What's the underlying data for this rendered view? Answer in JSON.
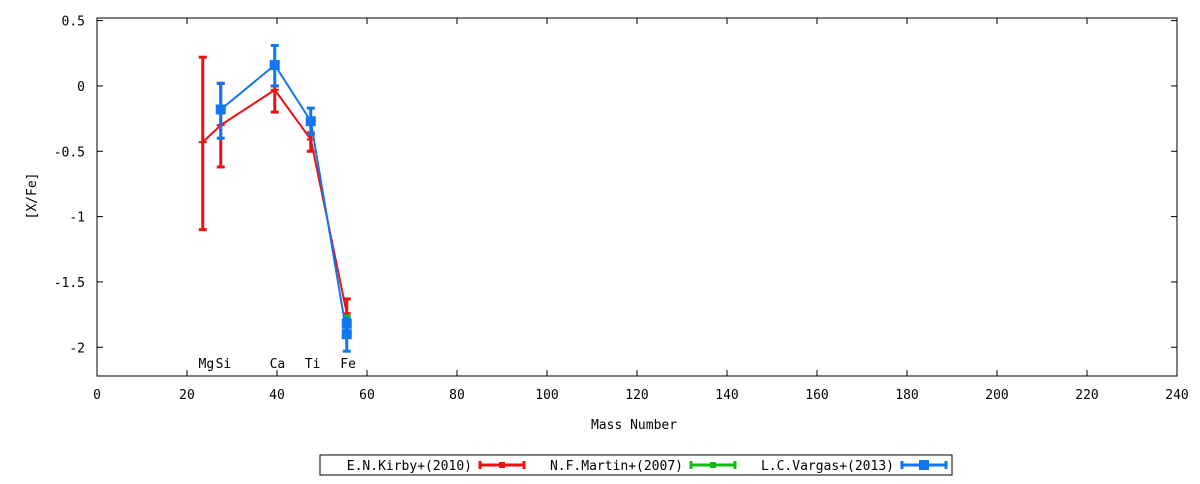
{
  "chart_data": {
    "type": "line",
    "xlabel": "Mass Number",
    "ylabel": "[X/Fe]",
    "xlim": [
      0,
      240
    ],
    "ylim": [
      -2.22,
      0.52
    ],
    "x_ticks": [
      0,
      20,
      40,
      60,
      80,
      100,
      120,
      140,
      160,
      180,
      200,
      220,
      240
    ],
    "y_ticks": [
      0.5,
      0,
      -0.5,
      -1,
      -1.5,
      -2
    ],
    "y_tick_labels": [
      "0.5",
      "0",
      "-0.5",
      "-1",
      "-1.5",
      "-2"
    ],
    "grid": false,
    "legend_position": "bottom-center",
    "element_labels": [
      {
        "text": "Mg",
        "x": 24.3
      },
      {
        "text": "Si",
        "x": 28.1
      },
      {
        "text": "Ca",
        "x": 40.1
      },
      {
        "text": "Ti",
        "x": 47.9
      },
      {
        "text": "Fe",
        "x": 55.8
      }
    ],
    "series": [
      {
        "name": "E.N.Kirby+(2010)",
        "color": "#ee1111",
        "marker": "none",
        "points": [
          {
            "x": 23.5,
            "y": -0.43,
            "ylo": -1.1,
            "yhi": 0.22
          },
          {
            "x": 27.5,
            "y": -0.3,
            "ylo": -0.62,
            "yhi": 0.02
          },
          {
            "x": 39.5,
            "y": -0.03,
            "ylo": -0.2,
            "yhi": 0.0
          },
          {
            "x": 47.5,
            "y": -0.41,
            "ylo": -0.5,
            "yhi": -0.36
          },
          {
            "x": 55.5,
            "y": -1.74,
            "ylo": -1.82,
            "yhi": -1.63
          }
        ]
      },
      {
        "name": "N.F.Martin+(2007)",
        "color": "#11bb11",
        "marker": "none",
        "points": [
          {
            "x": 55.5,
            "y": -1.8,
            "ylo": -1.84,
            "yhi": -1.76
          }
        ]
      },
      {
        "name": "L.C.Vargas+(2013)",
        "color": "#1177ee",
        "marker": "square",
        "points": [
          {
            "x": 27.5,
            "y": -0.18,
            "ylo": -0.4,
            "yhi": 0.02
          },
          {
            "x": 39.5,
            "y": 0.16,
            "ylo": 0.0,
            "yhi": 0.31
          },
          {
            "x": 47.5,
            "y": -0.27,
            "ylo": -0.37,
            "yhi": -0.17
          },
          {
            "x": 55.5,
            "y": -1.9,
            "ylo": -2.03,
            "yhi": -1.78
          },
          {
            "x": 55.5,
            "y": -1.82,
            "ylo": -1.84,
            "yhi": -1.79
          }
        ]
      }
    ]
  }
}
